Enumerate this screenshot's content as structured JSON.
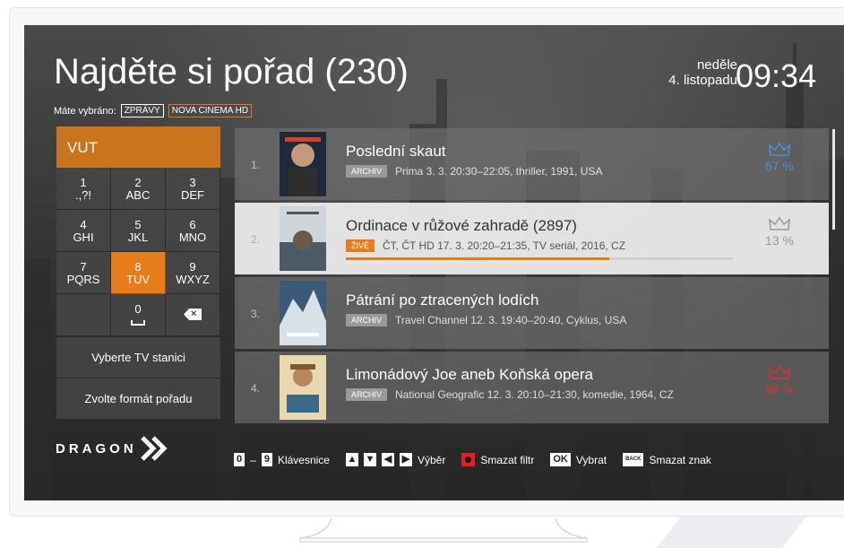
{
  "header": {
    "title": "Najděte si pořad (230)",
    "day": "neděle",
    "date": "4. listopadu",
    "time": "09:34",
    "selected_label": "Máte vybráno:",
    "selected_tags": [
      "ZPRÁVY",
      "NOVA CINEMA HD"
    ]
  },
  "keypad": {
    "search_text": "VUT",
    "keys": [
      {
        "digit": "1",
        "letters": ".,?!"
      },
      {
        "digit": "2",
        "letters": "ABC"
      },
      {
        "digit": "3",
        "letters": "DEF"
      },
      {
        "digit": "4",
        "letters": "GHI"
      },
      {
        "digit": "5",
        "letters": "JKL"
      },
      {
        "digit": "6",
        "letters": "MNO"
      },
      {
        "digit": "7",
        "letters": "PQRS"
      },
      {
        "digit": "8",
        "letters": "TUV"
      },
      {
        "digit": "9",
        "letters": "WXYZ"
      },
      {
        "digit": "0",
        "letters": ""
      }
    ],
    "active_key": "8",
    "backspace_icon": "backspace-icon",
    "menu": [
      "Vyberte TV stanici",
      "Zvolte formát pořadu"
    ]
  },
  "results": [
    {
      "num": "1.",
      "title": "Poslední skaut",
      "badge": "ARCHIV",
      "info": "Prima 3. 3. 20:30–22:05, thriller, 1991, USA",
      "score": "67 %",
      "score_color": "#4a8fd6"
    },
    {
      "num": "2.",
      "title": "Ordinace v růžové zahradě (2897)",
      "badge": "ŽIVĚ",
      "info": "ČT, ČT HD 17. 3. 20:20–21:35, TV seriál, 2016, CZ",
      "score": "13 %",
      "score_color": "#999999",
      "progress": 0.68
    },
    {
      "num": "3.",
      "title": "Pátrání po ztracených lodích",
      "badge": "ARCHIV",
      "info": "Travel Channel 12. 3. 19:40–20:40, Cyklus, USA"
    },
    {
      "num": "4.",
      "title": "Limonádový Joe aneb Koňská opera",
      "badge": "ARCHIV",
      "info": "National Geografic 12. 3. 20:10–21:30, komedie, 1964, CZ",
      "score": "88 %",
      "score_color": "#d93030"
    }
  ],
  "footer": {
    "logo": "DRAGON",
    "hints": {
      "keys_from": "0",
      "keys_to": "9",
      "keypad": "Klávesnice",
      "select": "Výběr",
      "clear_filter": "Smazat filtr",
      "ok_key": "OK",
      "confirm": "Vybrat",
      "back_key": "BACK",
      "delete_char": "Smazat znak"
    }
  },
  "colors": {
    "accent": "#e67d1a",
    "accent_dark": "#c9741f",
    "archiv": "#9a9a9a",
    "red": "#e02020"
  }
}
